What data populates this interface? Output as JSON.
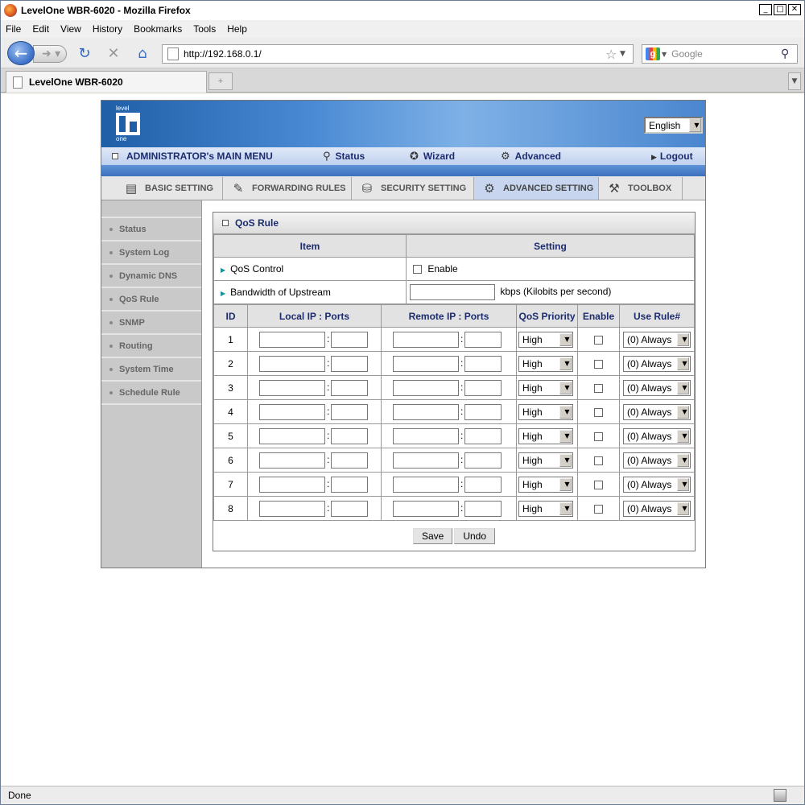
{
  "window": {
    "title": "LevelOne WBR-6020 - Mozilla Firefox"
  },
  "menubar": [
    "File",
    "Edit",
    "View",
    "History",
    "Bookmarks",
    "Tools",
    "Help"
  ],
  "toolbar": {
    "url": "http://192.168.0.1/",
    "search_placeholder": "Google"
  },
  "tab": {
    "title": "LevelOne WBR-6020"
  },
  "status": "Done",
  "router": {
    "logo_top": "level",
    "logo_bottom": "one",
    "language": "English",
    "admin_menu": "ADMINISTRATOR's MAIN MENU",
    "nav": {
      "status": "Status",
      "wizard": "Wizard",
      "advanced": "Advanced",
      "logout": "Logout"
    },
    "tabs": [
      "BASIC SETTING",
      "FORWARDING RULES",
      "SECURITY SETTING",
      "ADVANCED SETTING",
      "TOOLBOX"
    ],
    "sidebar": [
      "Status",
      "System Log",
      "Dynamic DNS",
      "QoS Rule",
      "SNMP",
      "Routing",
      "System Time",
      "Schedule Rule"
    ],
    "panel_title": "QoS Rule",
    "item_header": "Item",
    "setting_header": "Setting",
    "qos_control": "QoS Control",
    "enable_label": "Enable",
    "bandwidth": "Bandwidth of Upstream",
    "kbps": "kbps (Kilobits per second)",
    "columns": [
      "ID",
      "Local IP : Ports",
      "Remote IP : Ports",
      "QoS Priority",
      "Enable",
      "Use Rule#"
    ],
    "rows": [
      {
        "id": "1",
        "priority": "High",
        "rule": "(0) Always"
      },
      {
        "id": "2",
        "priority": "High",
        "rule": "(0) Always"
      },
      {
        "id": "3",
        "priority": "High",
        "rule": "(0) Always"
      },
      {
        "id": "4",
        "priority": "High",
        "rule": "(0) Always"
      },
      {
        "id": "5",
        "priority": "High",
        "rule": "(0) Always"
      },
      {
        "id": "6",
        "priority": "High",
        "rule": "(0) Always"
      },
      {
        "id": "7",
        "priority": "High",
        "rule": "(0) Always"
      },
      {
        "id": "8",
        "priority": "High",
        "rule": "(0) Always"
      }
    ],
    "save": "Save",
    "undo": "Undo"
  }
}
